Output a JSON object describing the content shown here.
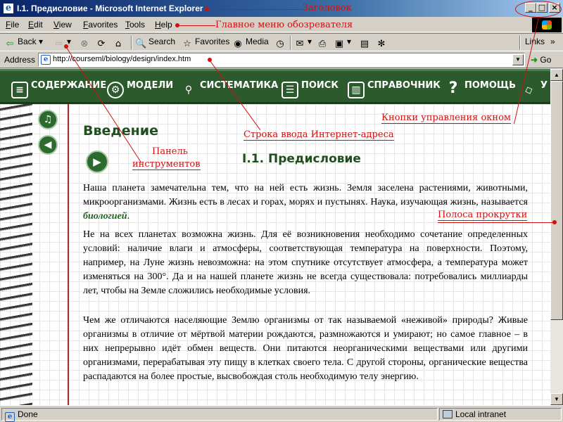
{
  "window": {
    "title": "I.1. Предисловие - Microsoft Internet Explorer"
  },
  "menu": [
    "File",
    "Edit",
    "View",
    "Favorites",
    "Tools",
    "Help"
  ],
  "toolbar": {
    "back": "Back",
    "search": "Search",
    "favorites": "Favorites",
    "media": "Media",
    "links": "Links"
  },
  "address": {
    "label": "Address",
    "url": "http://courseml/biology/design/index.htm",
    "go": "Go"
  },
  "site_nav": [
    {
      "label": "СОДЕРЖАНИЕ",
      "icon": "book-icon"
    },
    {
      "label": "МОДЕЛИ",
      "icon": "gears-icon"
    },
    {
      "label": "СИСТЕМАТИКА",
      "icon": "tree-icon"
    },
    {
      "label": "ПОИСК",
      "icon": "search-doc-icon"
    },
    {
      "label": "СПРАВОЧНИК",
      "icon": "reference-book-icon"
    },
    {
      "label": "ПОМОЩЬ",
      "icon": "question-icon"
    },
    {
      "label": "У",
      "icon": "graduation-cap-icon"
    }
  ],
  "content": {
    "heading": "Введение",
    "subheading": "I.1. Предисловие",
    "p1_before": "Наша планета замечательна тем, что на ней есть жизнь. Земля заселена растениями, животными, микроорганизмами. Жизнь есть в лесах и горах, морях и пустынях. Наука, изучающая жизнь, называется ",
    "p1_term": "биологией",
    "p1_after": ".",
    "p2": "Не на всех планетах возможна жизнь. Для её возникновения необходимо сочетание определенных условий: наличие влаги и атмосферы, соответствующая температура на поверхности. Поэтому, например, на Луне жизнь невозможна: на этом спутнике отсутствует атмосфера, а температура может изменяться на 300°. Да и на нашей планете жизнь не всегда существовала: потребовались миллиарды лет, чтобы на Земле сложились необходимые условия.",
    "p3": "Чем же отличаются населяющие Землю организмы от так называемой «неживой» природы? Живые организмы в отличие от мёртвой материи рождаются, размножаются и умирают; но самое главное – в них непрерывно идёт обмен веществ. Они питаются неорганическими веществами или другими организмами, перерабатывая эту пищу в клетках своего тела. С другой стороны, органические вещества распадаются на более простые, высвобождая столь необходимую телу энергию."
  },
  "status": {
    "left": "Done",
    "zone": "Local intranet"
  },
  "annotations": {
    "title_bar": "Заголовок",
    "menu": "Главное меню обозревателя",
    "window_buttons": "Кнопки управления окном",
    "address_bar": "Строка ввода Интернет-адреса",
    "toolbar_line1": "Панель",
    "toolbar_line2": "инструментов",
    "scrollbar": "Полоса прокрутки"
  },
  "colors": {
    "annotation": "#d21010",
    "site_nav_bg": "#2d5a2d",
    "heading": "#1f4f1f"
  }
}
